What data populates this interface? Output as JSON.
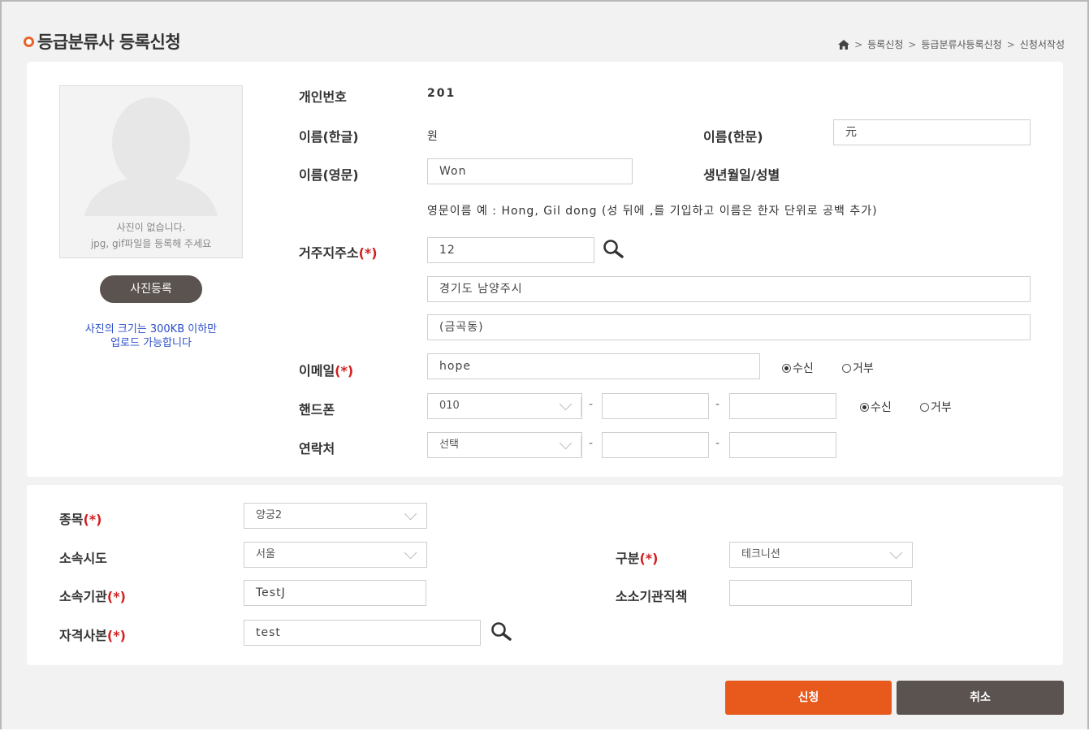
{
  "page": {
    "title": "등급분류사 등록신청",
    "breadcrumb": [
      "등록신청",
      "등급분류사등록신청",
      "신청서작성"
    ]
  },
  "photo": {
    "empty_line1": "사진이 없습니다.",
    "empty_line2": "jpg, gif파일을 등록해 주세요",
    "register_button": "사진등록",
    "note_line1": "사진의 크기는 300KB 이하만",
    "note_line2": "업로드 가능합니다"
  },
  "personal": {
    "id_label": "개인번호",
    "id_value": "201",
    "name_kr_label": "이름(한글)",
    "name_kr_value": "원",
    "name_hanja_label": "이름(한문)",
    "name_hanja_value": "元",
    "name_en_label": "이름(영문)",
    "name_en_value": "Won",
    "birth_gender_label": "생년월일/성별",
    "name_en_hint": "영문이름 예 : Hong, Gil dong (성 뒤에 ,를 기입하고 이름은 한자 단위로 공백 추가)",
    "address_label": "거주지주소",
    "required_mark": "(*)",
    "zip_value": "12",
    "address1_value": "경기도 남양주시",
    "address2_value": "(금곡동)",
    "email_label": "이메일",
    "email_value": "hope",
    "email_receive": "수신",
    "email_refuse": "거부",
    "phone_label": "핸드폰",
    "phone_prefix": "010",
    "phone_receive": "수신",
    "phone_refuse": "거부",
    "contact_label": "연락처",
    "contact_prefix": "선택",
    "dash": "-"
  },
  "affiliation": {
    "sport_label": "종목",
    "sport_value": "양궁2",
    "city_label": "소속시도",
    "city_value": "서울",
    "category_label": "구분",
    "category_value": "테크니션",
    "org_label": "소속기관",
    "org_value": "TestJ",
    "org_position_label": "소소기관직책",
    "org_position_value": "",
    "cert_label": "자격사본",
    "cert_value": "test"
  },
  "actions": {
    "submit": "신청",
    "cancel": "취소"
  },
  "colors": {
    "accent": "#e8591c",
    "dark_button": "#5a5350",
    "required": "#d21f1f",
    "note_blue": "#2a4fc9"
  },
  "icons": [
    "home-icon",
    "search-icon",
    "chevron-down-icon",
    "avatar-placeholder-icon"
  ]
}
